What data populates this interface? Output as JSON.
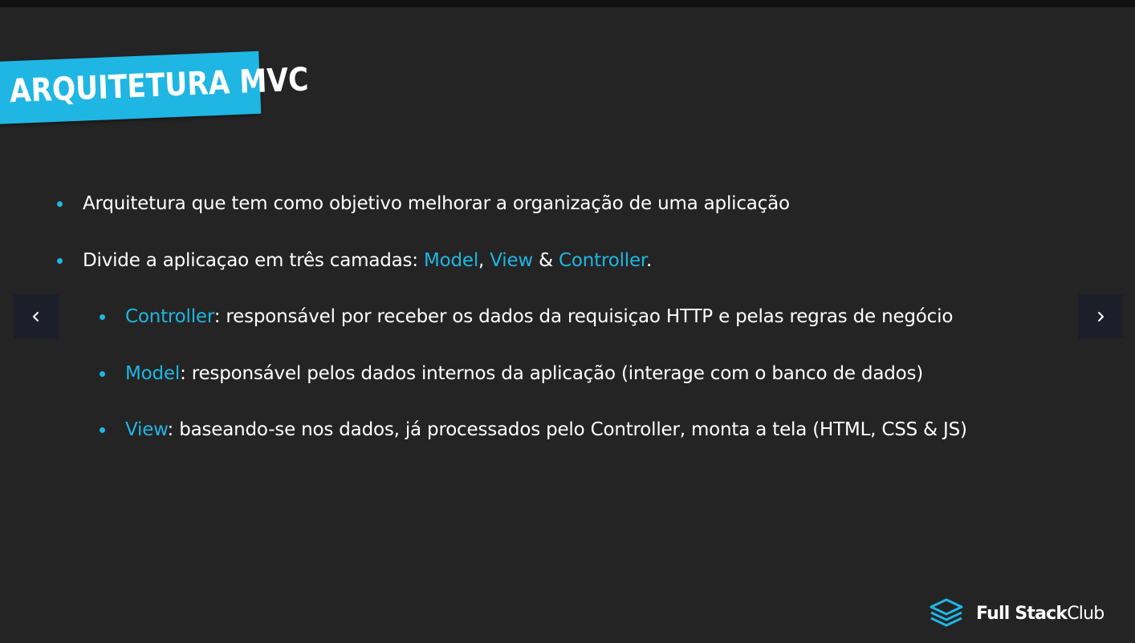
{
  "slide": {
    "title": "ARQUITETURA MVC",
    "bullets": [
      {
        "level": 1,
        "segments": [
          {
            "text": "Arquitetura que tem como objetivo melhorar a organização de uma aplicação",
            "highlight": false
          }
        ]
      },
      {
        "level": 1,
        "segments": [
          {
            "text": "Divide a aplicaçao em três camadas: ",
            "highlight": false
          },
          {
            "text": "Model",
            "highlight": true
          },
          {
            "text": ", ",
            "highlight": false
          },
          {
            "text": "View",
            "highlight": true
          },
          {
            "text": " & ",
            "highlight": false
          },
          {
            "text": "Controller",
            "highlight": true
          },
          {
            "text": ".",
            "highlight": false
          }
        ]
      },
      {
        "level": 2,
        "segments": [
          {
            "text": "Controller",
            "highlight": true
          },
          {
            "text": ": responsável por receber os dados da requisiçao HTTP e pelas regras de negócio",
            "highlight": false
          }
        ]
      },
      {
        "level": 2,
        "segments": [
          {
            "text": "Model",
            "highlight": true
          },
          {
            "text": ": responsável pelos dados internos da aplicação (interage com o banco de dados)",
            "highlight": false
          }
        ]
      },
      {
        "level": 2,
        "segments": [
          {
            "text": "View",
            "highlight": true
          },
          {
            "text": ": baseando-se nos dados, já processados pelo Controller, monta a tela (HTML, CSS & JS)",
            "highlight": false
          }
        ]
      }
    ]
  },
  "nav": {
    "prev_icon": "chevron-left-icon",
    "next_icon": "chevron-right-icon"
  },
  "brand": {
    "name_bold": "Full Stack",
    "name_light": "Club",
    "icon": "stacked-layers-icon"
  },
  "colors": {
    "accent": "#1fb6e3",
    "background": "#242424",
    "text": "#ffffff",
    "nav_button": "#1c1f2a"
  }
}
